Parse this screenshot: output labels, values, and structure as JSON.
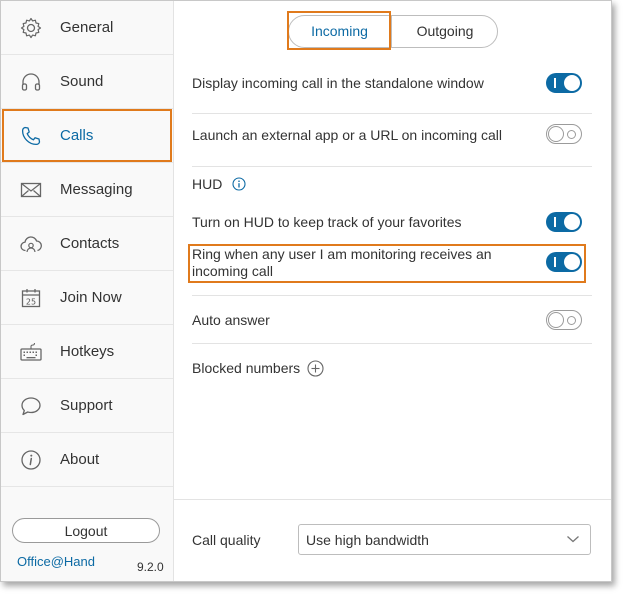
{
  "sidebar": {
    "items": [
      {
        "label": "General",
        "icon": "gear-icon"
      },
      {
        "label": "Sound",
        "icon": "headphones-icon"
      },
      {
        "label": "Calls",
        "icon": "phone-icon"
      },
      {
        "label": "Messaging",
        "icon": "envelope-icon"
      },
      {
        "label": "Contacts",
        "icon": "contacts-cloud-icon"
      },
      {
        "label": "Join Now",
        "icon": "calendar-icon"
      },
      {
        "label": "Hotkeys",
        "icon": "keyboard-icon"
      },
      {
        "label": "Support",
        "icon": "speech-bubble-icon"
      },
      {
        "label": "About",
        "icon": "info-icon"
      }
    ],
    "active": "Calls",
    "logout_label": "Logout",
    "brand": "Office@Hand",
    "version": "9.2.0"
  },
  "tabs": {
    "incoming": "Incoming",
    "outgoing": "Outgoing",
    "active": "Incoming"
  },
  "settings": {
    "standalone_window": {
      "label": "Display incoming call in the standalone window",
      "on": true
    },
    "external_app": {
      "label": "Launch an external app or a URL on incoming call",
      "on": false
    },
    "hud_heading": "HUD",
    "hud_favorites": {
      "label": "Turn on HUD to keep track of your favorites",
      "on": true
    },
    "ring_monitoring": {
      "label_line1": "Ring when any user I am monitoring receives an",
      "label_line2": "incoming call",
      "on": true
    },
    "auto_answer": {
      "label": "Auto answer",
      "on": false
    },
    "blocked_numbers": "Blocked numbers"
  },
  "call_quality": {
    "label": "Call quality",
    "selected": "Use high bandwidth"
  },
  "colors": {
    "accent": "#0c6aa4",
    "highlight": "#e07a1c"
  }
}
